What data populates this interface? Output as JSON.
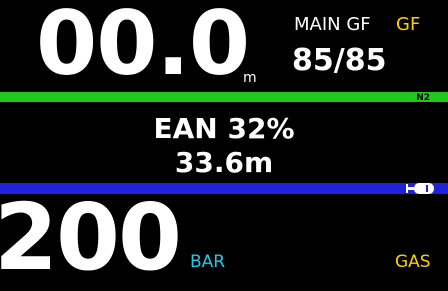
{
  "depth": {
    "value": "00.0",
    "unit": "m"
  },
  "gradient_factor": {
    "mode_label": "MAIN GF",
    "tag": "GF",
    "value": "85/85"
  },
  "gas_bar": {
    "label": "N2"
  },
  "gas": {
    "name": "EAN 32%",
    "mod": "33.6m"
  },
  "tank": {
    "icon": "tank-icon"
  },
  "pressure": {
    "value": "200",
    "unit": "BAR"
  },
  "soft_button": {
    "label": "GAS"
  },
  "colors": {
    "background": "#000000",
    "text": "#ffffff",
    "accent_yellow": "#ffd000",
    "n2_bar": "#22c81e",
    "blue_bar": "#1e22d8",
    "pressure_unit": "#25c9e8"
  }
}
